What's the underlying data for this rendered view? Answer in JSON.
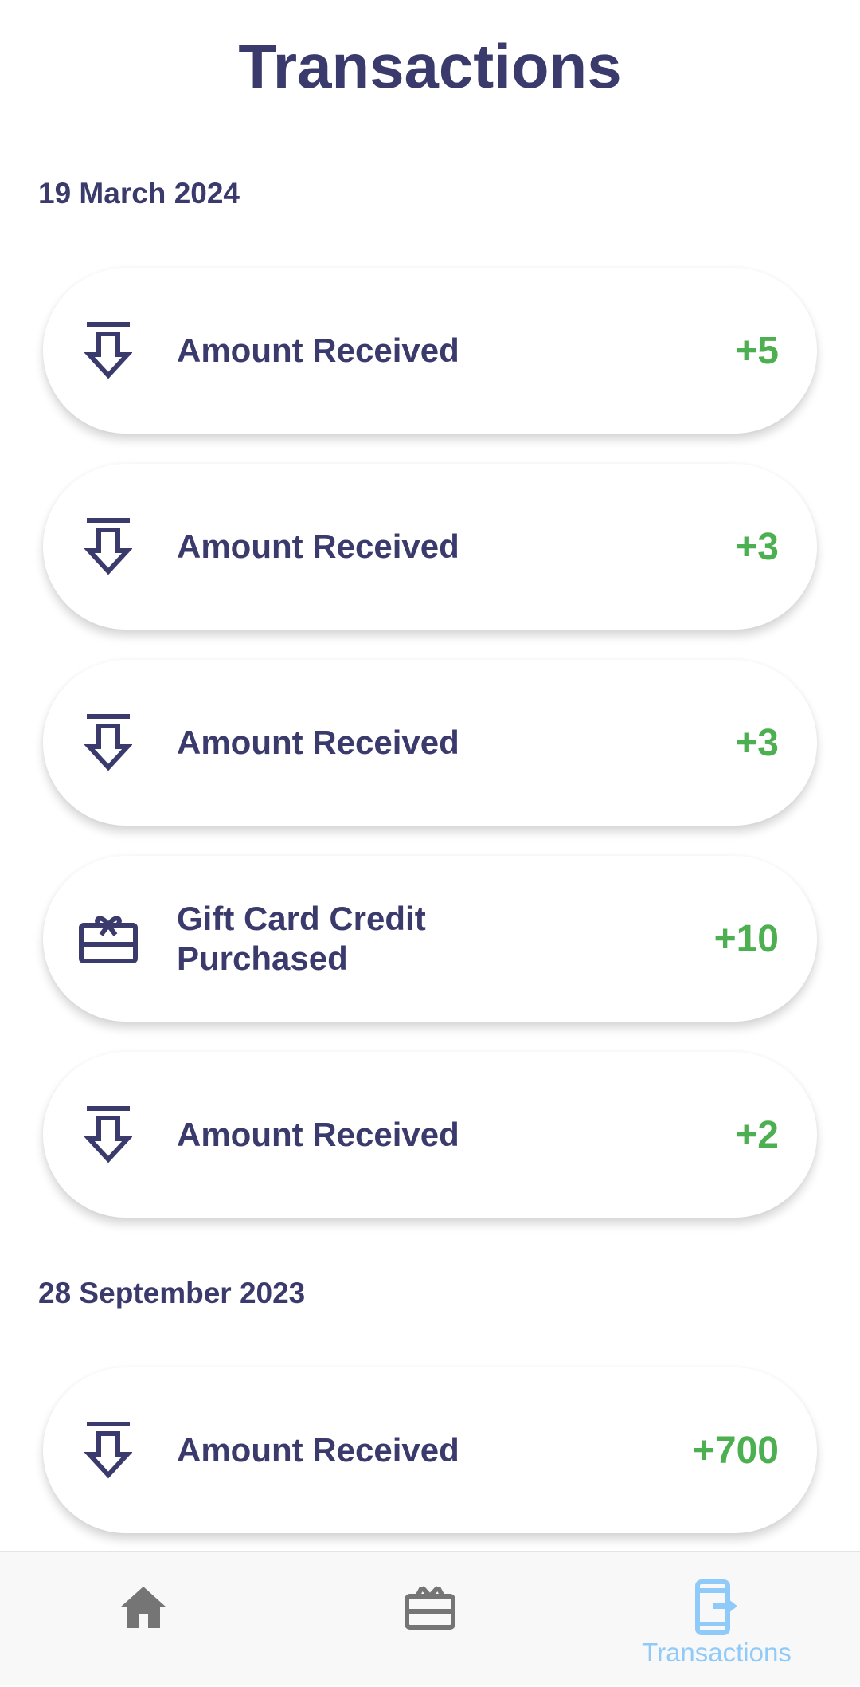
{
  "header": {
    "title": "Transactions"
  },
  "groups": [
    {
      "date": "19 March 2024",
      "transactions": [
        {
          "label": "Amount Received",
          "amount": "+5",
          "icon": "download-arrow-icon"
        },
        {
          "label": "Amount Received",
          "amount": "+3",
          "icon": "download-arrow-icon"
        },
        {
          "label": "Amount Received",
          "amount": "+3",
          "icon": "download-arrow-icon"
        },
        {
          "label": "Gift Card Credit Purchased",
          "amount": "+10",
          "icon": "gift-card-icon"
        },
        {
          "label": "Amount Received",
          "amount": "+2",
          "icon": "download-arrow-icon"
        }
      ]
    },
    {
      "date": "28 September 2023",
      "transactions": [
        {
          "label": "Amount Received",
          "amount": "+700",
          "icon": "download-arrow-icon"
        }
      ]
    }
  ],
  "bottom_nav": {
    "items": [
      {
        "icon": "home-icon",
        "label": ""
      },
      {
        "icon": "gift-card-icon",
        "label": ""
      },
      {
        "icon": "transactions-icon",
        "label": "Transactions",
        "active": true
      }
    ]
  },
  "colors": {
    "primary_text": "#3a3a6c",
    "positive_amount": "#4caf50",
    "nav_inactive": "#757575",
    "nav_active": "#90caf9"
  }
}
